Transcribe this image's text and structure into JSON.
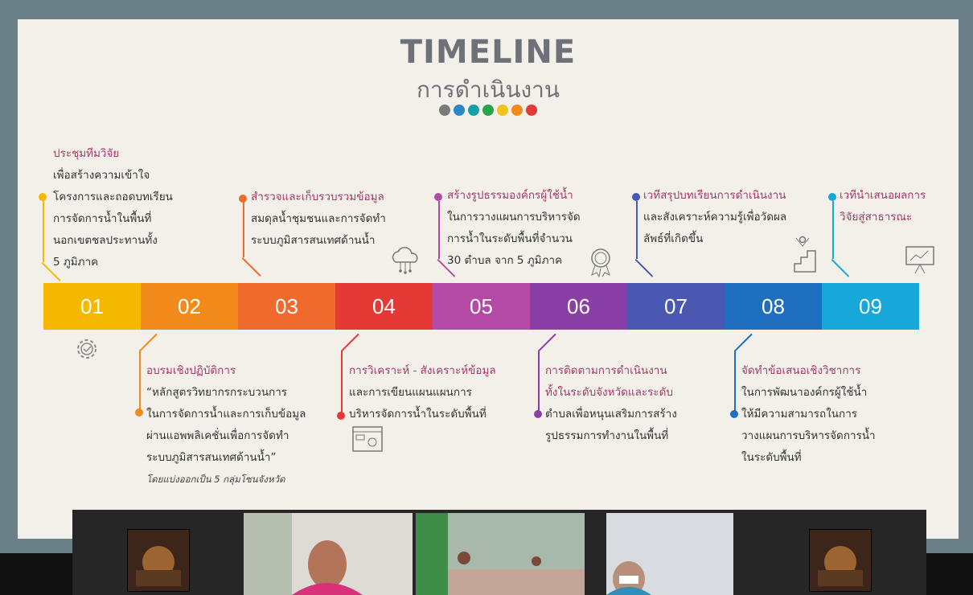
{
  "slide": {
    "title_en": "TIMELINE",
    "title_th": "การดำเนินงาน",
    "dot_colors": [
      "#7a7a7a",
      "#2d86c8",
      "#17a0a8",
      "#28a34a",
      "#f2c21d",
      "#f28a1c",
      "#e53935"
    ],
    "steps": [
      {
        "num": "01",
        "color": "#f5b800"
      },
      {
        "num": "02",
        "color": "#f28a1c"
      },
      {
        "num": "03",
        "color": "#ef6a2c"
      },
      {
        "num": "04",
        "color": "#e53935"
      },
      {
        "num": "05",
        "color": "#b54aa6"
      },
      {
        "num": "06",
        "color": "#8a3fa6"
      },
      {
        "num": "07",
        "color": "#4a57b3"
      },
      {
        "num": "08",
        "color": "#1f6fc1"
      },
      {
        "num": "09",
        "color": "#17a7d9"
      }
    ],
    "texts": {
      "s01": {
        "head": "ประชุมทีมวิจัย",
        "lines": [
          "เพื่อสร้างความเข้าใจ",
          "โครงการและถอดบทเรียน",
          "การจัดการน้ำในพื้นที่",
          "นอกเขตชลประทานทั้ง",
          "5 ภูมิภาค"
        ]
      },
      "s02": {
        "head": "อบรมเชิงปฏิบัติการ",
        "lines": [
          "“หลักสูตรวิทยากรกระบวนการ",
          "ในการจัดการน้ำและการเก็บข้อมูล",
          "ผ่านแอพพลิเคชั่นเพื่อการจัดทำ",
          "ระบบภูมิสารสนเทศด้านน้ำ”"
        ],
        "note": "โดยแบ่งออกเป็น 5 กลุ่มโซนจังหวัด"
      },
      "s03": {
        "head": "สำรวจและเก็บรวบรวมข้อมูล",
        "lines": [
          "สมดุลน้ำชุมชนและการจัดทำ",
          "ระบบภูมิสารสนเทศด้านน้ำ"
        ]
      },
      "s04": {
        "head": "การวิเคราะห์ - สังเคราะห์ข้อมูล",
        "lines": [
          "และการเขียนแผนแผนการ",
          "บริหารจัดการน้ำในระดับพื้นที่"
        ]
      },
      "s05": {
        "head": "สร้างรูปธรรมองค์กรผู้ใช้น้ำ",
        "lines": [
          "ในการวางแผนการบริหารจัด",
          "การน้ำในระดับพื้นที่จำนวน",
          "30 ตำบล จาก 5 ภูมิภาค"
        ]
      },
      "s06": {
        "head": "การติดตามการดำเนินงาน",
        "lines": [
          "ทั้งในระดับจังหวัดและระดับ",
          "ตำบลเพื่อหนุนเสริมการสร้าง",
          "รูปธรรมการทำงานในพื้นที่"
        ]
      },
      "s07": {
        "head": "เวทีสรุปบทเรียนการดำเนินงาน",
        "lines": [
          "และสังเคราะห์ความรู้เพื่อวัดผล",
          "ลัพธ์ที่เกิดขึ้น"
        ]
      },
      "s08": {
        "head": "จัดทำข้อเสนอเชิงวิชาการ",
        "lines": [
          "ในการพัฒนาองค์กรผู้ใช้น้ำ",
          "ให้มีความสามารถในการ",
          "วางแผนการบริหารจัดการน้ำ",
          "ในระดับพื้นที่"
        ]
      },
      "s09": {
        "head": "เวทีนำเสนอผลการ",
        "lines": [
          "วิจัยสู่สาธารณะ"
        ]
      }
    }
  },
  "icons": [
    "gear-check-icon",
    "cloud-network-icon",
    "analytics-window-icon",
    "award-ribbon-icon",
    "stairs-success-icon",
    "presentation-board-icon"
  ],
  "video_strip": [
    "participant-tile-1",
    "participant-tile-2",
    "participant-tile-3",
    "participant-tile-4",
    "participant-tile-5"
  ]
}
